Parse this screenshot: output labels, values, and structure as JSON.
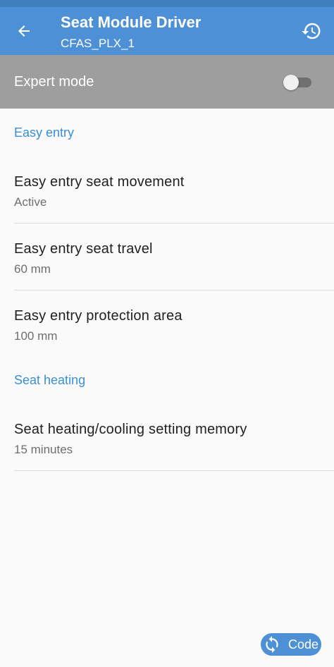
{
  "app_bar": {
    "title": "Seat Module Driver",
    "subtitle": "CFAS_PLX_1",
    "back_icon": "arrow-left-icon",
    "history_icon": "history-icon"
  },
  "expert_mode": {
    "label": "Expert mode",
    "enabled": false
  },
  "sections": [
    {
      "header": "Easy entry",
      "items": [
        {
          "title": "Easy entry seat movement",
          "value": "Active"
        },
        {
          "title": "Easy entry seat travel",
          "value": "60 mm"
        },
        {
          "title": "Easy entry protection area",
          "value": "100 mm"
        }
      ]
    },
    {
      "header": "Seat heating",
      "items": [
        {
          "title": "Seat heating/cooling setting memory",
          "value": "15 minutes"
        }
      ]
    }
  ],
  "code_button": {
    "label": "Code",
    "icon": "sync-icon"
  },
  "colors": {
    "app_bar": "#4d90d6",
    "expert_bar": "#9e9e9e",
    "accent": "#3b8fd3"
  }
}
